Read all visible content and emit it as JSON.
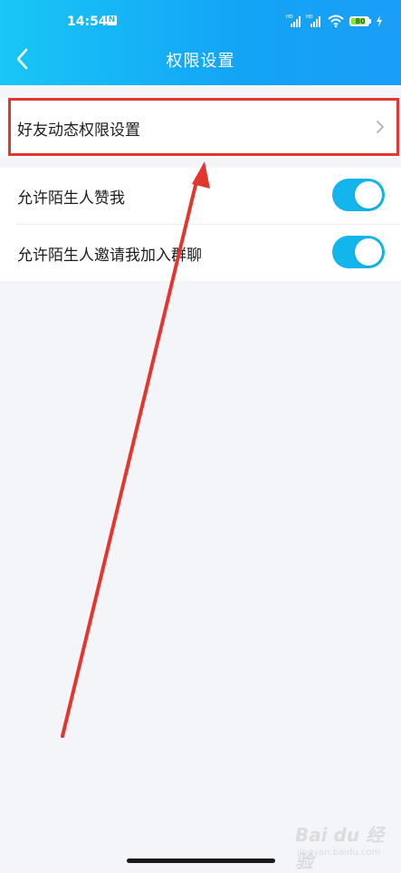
{
  "status_bar": {
    "time": "14:54",
    "notification_icon": "N",
    "battery": "80"
  },
  "header": {
    "title": "权限设置",
    "back_icon": "chevron-left-icon"
  },
  "section1": {
    "rows": [
      {
        "label": "好友动态权限设置",
        "trailing_icon": "chevron-right-icon"
      }
    ]
  },
  "section2": {
    "rows": [
      {
        "label": "允许陌生人赞我",
        "toggle_on": true
      },
      {
        "label": "允许陌生人邀请我加入群聊",
        "toggle_on": true
      }
    ]
  },
  "watermark": {
    "brand": "Bai du 经验",
    "url": "jingyan.baidu.com"
  },
  "colors": {
    "header_gradient_start": "#19c6f6",
    "header_gradient_end": "#1a9ef7",
    "toggle_on": "#12b5ec",
    "annotation_red": "#e3362f",
    "page_background": "#f4f5f9"
  }
}
